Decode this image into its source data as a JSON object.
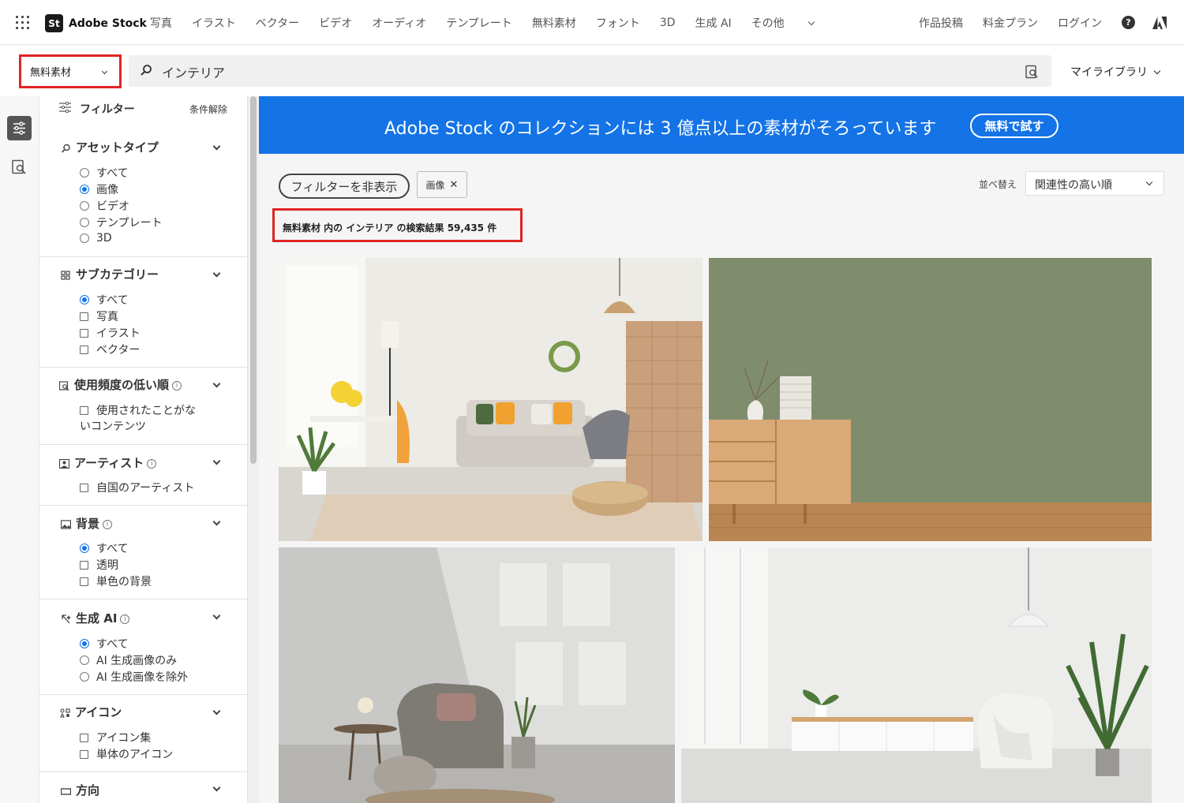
{
  "brand": {
    "mark": "St",
    "name": "Adobe Stock"
  },
  "nav": {
    "items": [
      "写真",
      "イラスト",
      "ベクター",
      "ビデオ",
      "オーディオ",
      "テンプレート",
      "無料素材",
      "フォント",
      "3D",
      "生成 AI"
    ],
    "more": "その他",
    "right": [
      "作品投稿",
      "料金プラン",
      "ログイン"
    ],
    "help": "?"
  },
  "search": {
    "scope": "無料素材",
    "query": "インテリア",
    "my_library": "マイライブラリ"
  },
  "filters": {
    "title": "フィルター",
    "clear": "条件解除",
    "sections": [
      {
        "title": "アセットタイプ",
        "options": [
          {
            "label": "すべて",
            "type": "radio",
            "checked": false
          },
          {
            "label": "画像",
            "type": "radio",
            "checked": true
          },
          {
            "label": "ビデオ",
            "type": "radio",
            "checked": false
          },
          {
            "label": "テンプレート",
            "type": "radio",
            "checked": false
          },
          {
            "label": "3D",
            "type": "radio",
            "checked": false
          }
        ]
      },
      {
        "title": "サブカテゴリー",
        "options": [
          {
            "label": "すべて",
            "type": "radio",
            "checked": true
          },
          {
            "label": "写真",
            "type": "checkbox",
            "checked": false
          },
          {
            "label": "イラスト",
            "type": "checkbox",
            "checked": false
          },
          {
            "label": "ベクター",
            "type": "checkbox",
            "checked": false
          }
        ]
      },
      {
        "title": "使用頻度の低い順",
        "options": [
          {
            "label": "使用されたことがな",
            "label2": "いコンテンツ",
            "type": "checkbox",
            "checked": false
          }
        ]
      },
      {
        "title": "アーティスト",
        "options": [
          {
            "label": "自国のアーティスト",
            "type": "checkbox",
            "checked": false
          }
        ]
      },
      {
        "title": "背景",
        "options": [
          {
            "label": "すべて",
            "type": "radio",
            "checked": true
          },
          {
            "label": "透明",
            "type": "checkbox",
            "checked": false
          },
          {
            "label": "単色の背景",
            "type": "checkbox",
            "checked": false
          }
        ]
      },
      {
        "title": "生成 AI",
        "options": [
          {
            "label": "すべて",
            "type": "radio",
            "checked": true
          },
          {
            "label": "AI 生成画像のみ",
            "type": "radio",
            "checked": false
          },
          {
            "label": "AI 生成画像を除外",
            "type": "radio",
            "checked": false
          }
        ]
      },
      {
        "title": "アイコン",
        "options": [
          {
            "label": "アイコン集",
            "type": "checkbox",
            "checked": false
          },
          {
            "label": "単体のアイコン",
            "type": "checkbox",
            "checked": false
          }
        ]
      },
      {
        "title": "方向",
        "options": []
      }
    ]
  },
  "banner": {
    "text": "Adobe Stock のコレクションには 3 億点以上の素材がそろっています",
    "button": "無料で試す"
  },
  "toolbar": {
    "hide_filters": "フィルターを非表示",
    "active_tag": "画像",
    "sort_label": "並べ替え",
    "sort_value": "関連性の高い順"
  },
  "results": {
    "text": "無料素材 内の インテリア の検索結果 59,435 件"
  },
  "colors": {
    "accent": "#1473e6",
    "highlight": "#e02424"
  }
}
